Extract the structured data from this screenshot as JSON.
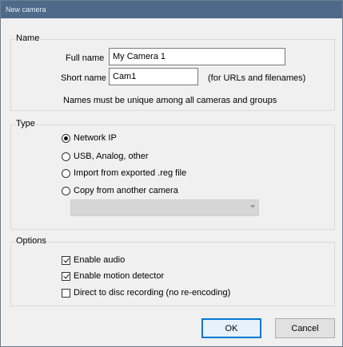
{
  "window": {
    "title": "New camera"
  },
  "name_group": {
    "label": "Name",
    "full_name_label": "Full name",
    "full_name_value": "My Camera 1",
    "short_name_label": "Short name",
    "short_name_value": "Cam1",
    "short_name_hint": "(for URLs and filenames)",
    "unique_note": "Names must be unique among all cameras and groups"
  },
  "type_group": {
    "label": "Type",
    "options": [
      {
        "label": "Network IP",
        "selected": true
      },
      {
        "label": "USB, Analog, other",
        "selected": false
      },
      {
        "label": "Import from exported .reg file",
        "selected": false
      },
      {
        "label": "Copy from another camera",
        "selected": false
      }
    ],
    "copy_source_value": ""
  },
  "options_group": {
    "label": "Options",
    "checks": [
      {
        "label": "Enable audio",
        "checked": true
      },
      {
        "label": "Enable motion detector",
        "checked": true
      },
      {
        "label": "Direct to disc recording (no re-encoding)",
        "checked": false
      }
    ]
  },
  "buttons": {
    "ok": "OK",
    "cancel": "Cancel"
  },
  "colors": {
    "titlebar": "#4e6a8a",
    "dialog_bg": "#f0f0f0",
    "default_button_border": "#0078d7"
  }
}
